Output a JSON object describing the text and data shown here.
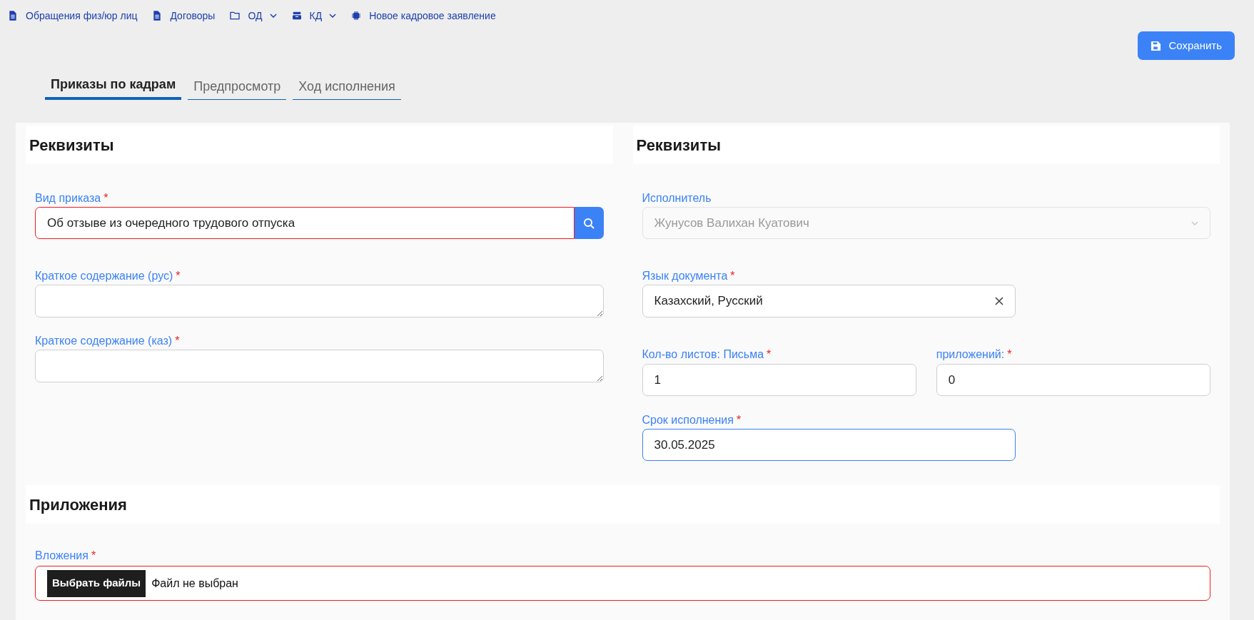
{
  "nav": [
    {
      "label": "Обращения физ/юр лиц",
      "kind": "document",
      "dropdown": false
    },
    {
      "label": "Договоры",
      "kind": "document",
      "dropdown": false
    },
    {
      "label": "ОД",
      "kind": "folder",
      "dropdown": true
    },
    {
      "label": "КД",
      "kind": "tray",
      "dropdown": true
    },
    {
      "label": "Новое кадровое заявление",
      "kind": "chip",
      "dropdown": false
    }
  ],
  "save_button": {
    "label": "Сохранить"
  },
  "tabs": [
    {
      "label": "Приказы по кадрам",
      "selected": true
    },
    {
      "label": "Предпросмотр",
      "selected": false
    },
    {
      "label": "Ход исполнения",
      "selected": false
    }
  ],
  "left_section": {
    "title": "Реквизиты",
    "fields": [
      {
        "kind": "lookup",
        "label": "Вид приказа",
        "required_mark": "*",
        "value": "Об отзыве из очередного трудового отпуска",
        "invalid": true
      },
      {
        "kind": "textarea",
        "label": "Краткое содержание (рус)",
        "required_mark": "*"
      },
      {
        "kind": "textarea",
        "label": "Краткое содержание (каз)",
        "required_mark": "*"
      }
    ]
  },
  "right_section": {
    "title": "Реквизиты",
    "executor": {
      "label": "Исполнитель",
      "value": "Жунусов Валихан Куатович",
      "disabled": true
    },
    "language": {
      "label": "Язык документа",
      "required_mark": "*",
      "value": "Казахский, Русский"
    },
    "sheets": {
      "label": "Кол-во листов: Письма",
      "required_mark": "*",
      "value": "1"
    },
    "attachments_count": {
      "label": "приложений:",
      "required_mark": "*",
      "value": "0"
    },
    "deadline": {
      "label": "Срок исполнения",
      "required_mark": "*",
      "value": "30.05.2025",
      "focused": true
    }
  },
  "attachments_section": {
    "title": "Приложения",
    "files": {
      "label": "Вложения",
      "required_mark": "*",
      "button": "Выбрать файлы",
      "status": "Файл не выбран",
      "invalid": true
    }
  }
}
